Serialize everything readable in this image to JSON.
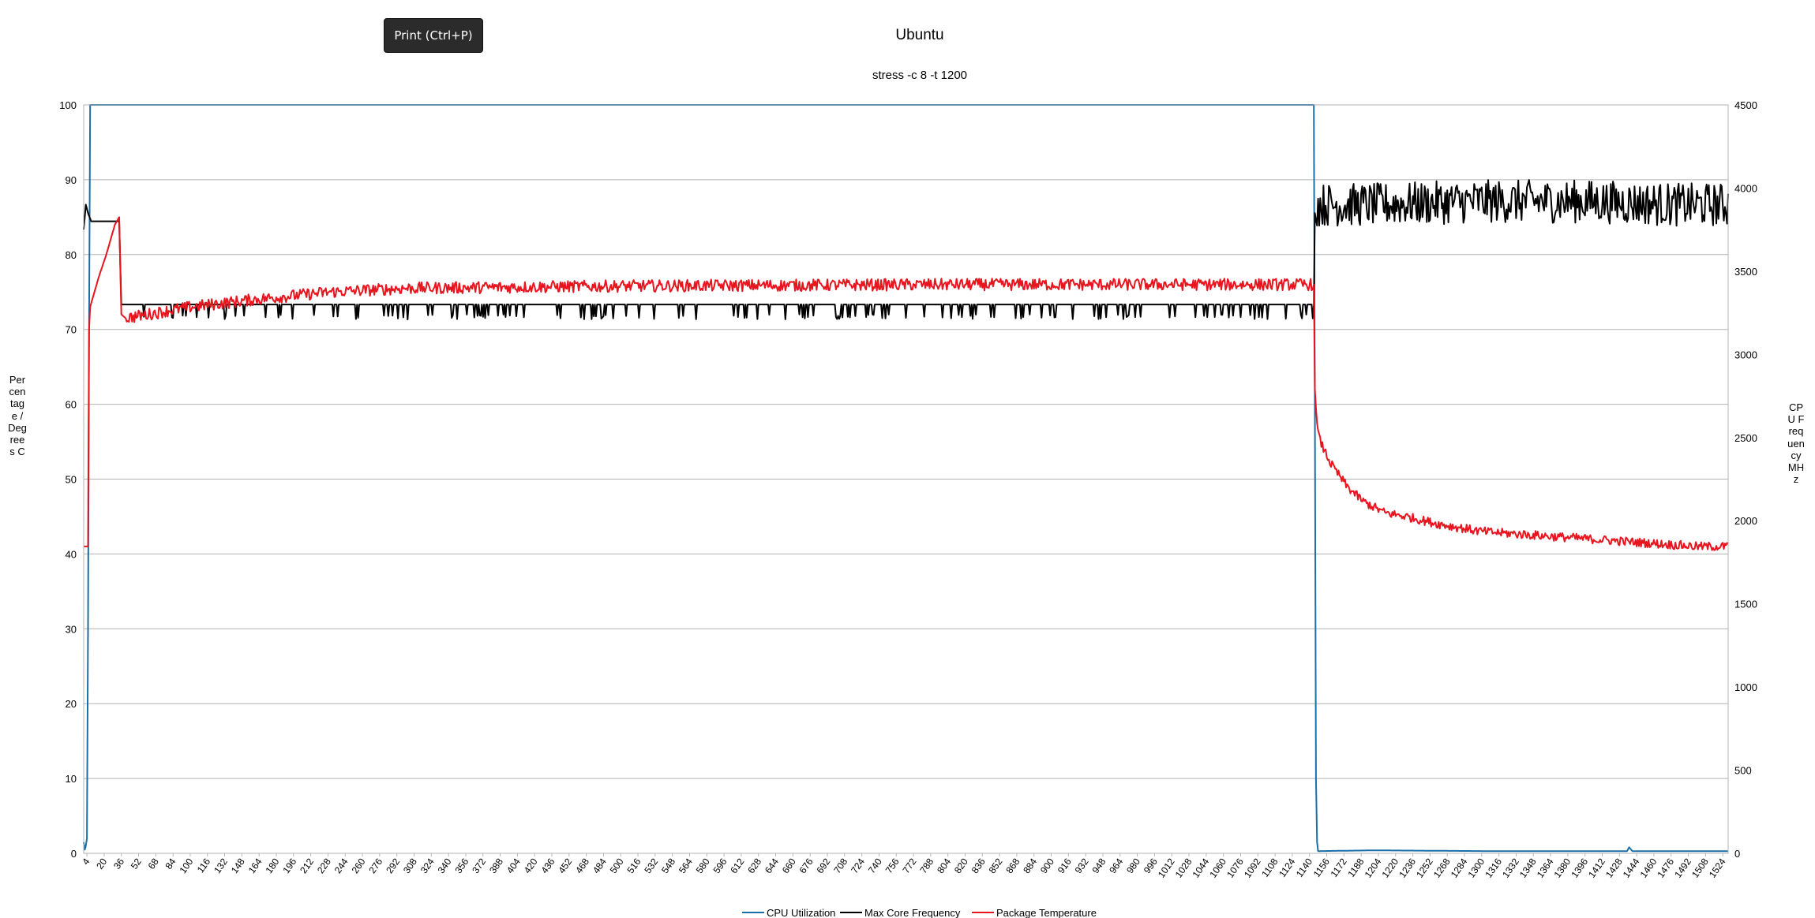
{
  "tooltip": {
    "label": "Print (Ctrl+P)"
  },
  "chart_data": {
    "type": "line",
    "title": "Ubuntu",
    "subtitle": "stress -c 8 -t 1200",
    "ylabel": "Percentage / Degrees C",
    "y2label": "CPU Frequency MHz",
    "ylim": [
      0,
      100
    ],
    "y2lim": [
      0,
      4500
    ],
    "xlim": [
      1,
      1529
    ],
    "yticks": [
      0,
      10,
      20,
      30,
      40,
      50,
      60,
      70,
      80,
      90,
      100
    ],
    "y2ticks": [
      0,
      500,
      1000,
      1500,
      2000,
      2500,
      3000,
      3500,
      4000,
      4500
    ],
    "xtick_start": 4,
    "xtick_step": 16,
    "xtick_end": 1524,
    "grid": true,
    "legend_position": "bottom",
    "series": [
      {
        "name": "CPU Utilization",
        "axis": "left",
        "color": "#1a6fa8",
        "x": [
          1,
          2,
          3,
          4,
          5,
          6,
          7,
          8,
          1144,
          1145,
          1146,
          1147,
          1148,
          1150,
          1200,
          1300,
          1400,
          1435,
          1437,
          1440,
          1500,
          1529
        ],
        "y": [
          1.5,
          0.5,
          1.0,
          2.0,
          30,
          70,
          100,
          100,
          100,
          60,
          10,
          1.5,
          0.3,
          0.3,
          0.4,
          0.3,
          0.3,
          0.3,
          0.8,
          0.3,
          0.3,
          0.3
        ]
      },
      {
        "name": "Max Core Frequency",
        "axis": "right",
        "color": "#000000",
        "x": [
          1,
          3,
          5,
          8,
          10,
          20,
          30,
          34,
          36,
          100,
          200,
          300,
          400,
          500,
          600,
          700,
          800,
          900,
          1000,
          1100,
          1144,
          1145,
          1146,
          1200,
          1300,
          1400,
          1480,
          1529
        ],
        "y": [
          3750,
          3900,
          3850,
          3800,
          3800,
          3800,
          3800,
          3800,
          3300,
          3300,
          3300,
          3300,
          3300,
          3300,
          3300,
          3300,
          3300,
          3300,
          3300,
          3300,
          3300,
          3850,
          3900,
          3900,
          3920,
          3920,
          3900,
          3900
        ]
      },
      {
        "name": "Package Temperature",
        "axis": "left",
        "color": "#e8141e",
        "x": [
          1,
          3,
          5,
          6,
          7,
          9,
          15,
          22,
          30,
          34,
          36,
          40,
          60,
          100,
          160,
          230,
          300,
          500,
          800,
          1000,
          1144,
          1145,
          1147,
          1150,
          1160,
          1175,
          1190,
          1210,
          1230,
          1260,
          1300,
          1350,
          1400,
          1450,
          1500,
          1529
        ],
        "y": [
          41,
          41,
          41,
          70,
          73,
          74,
          77,
          80,
          84,
          85,
          72,
          71.5,
          72,
          73,
          74,
          75,
          75.5,
          75.8,
          76,
          76,
          76,
          62,
          57,
          55,
          52,
          49,
          47,
          45.5,
          45,
          44,
          43,
          42.5,
          42,
          41.5,
          41,
          41
        ]
      }
    ]
  }
}
